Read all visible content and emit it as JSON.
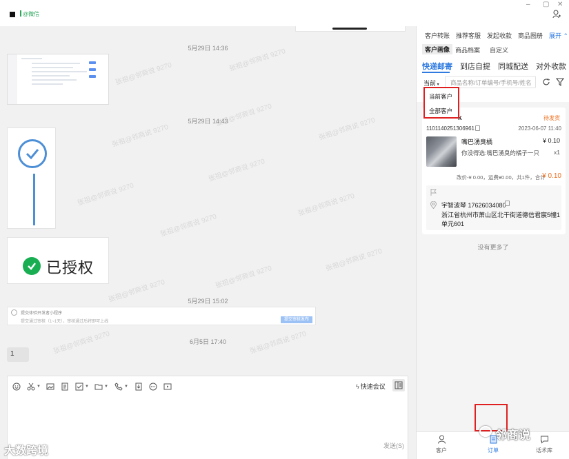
{
  "titlebar": {
    "app_name": "@微信",
    "minimize": "–",
    "maximize": "▢",
    "close": "✕"
  },
  "watermark": {
    "text": "张祖@邻商说 9270"
  },
  "chat": {
    "timestamps": [
      "5月29日 14:36",
      "5月29日 14:43",
      "5月29日 15:02",
      "6月5日 17:40"
    ],
    "auth_text": "已授权",
    "mini_card": {
      "title": "提交体验开发者小程序",
      "subtitle": "提交通过审核（1~1天），审核通过后将即可上线",
      "button": "提交审核发布"
    },
    "message": "1"
  },
  "input": {
    "quick_meeting": "快速会议",
    "send": "发送(S)"
  },
  "brand_watermark": "大数跨境",
  "panel": {
    "nav_top": [
      "客户转账",
      "推荐客服",
      "发起收款",
      "商品图册"
    ],
    "expand": "展开",
    "nav_second": [
      "客户画像",
      "商品档案",
      "自定义"
    ],
    "tabs": [
      "快递邮寄",
      "到店自提",
      "同城配送",
      "对外收款"
    ],
    "filter": "当前",
    "search_placeholder": "商品名称/订单编号/手机号/姓名",
    "dropdown": [
      "当前客户",
      "全部客户"
    ],
    "order": {
      "name": "k",
      "status": "待发货",
      "id": "1101140251306961",
      "date": "2023-06-07 11:40",
      "product_name": "嘴巴湧臭橘",
      "price": "¥ 0.10",
      "desc": "你没得选:嘴巴湧臭的橘子一只",
      "qty": "x1",
      "summary": "改价-¥ 0.00，运费¥0.00，共1件，合计",
      "total": "¥ 0.10",
      "contact": "宇智波琴 17626034080",
      "address_1": "浙江省杭州市萧山区北干街道德信君宸5幢1",
      "address_2": "单元601"
    },
    "no_more": "没有更多了",
    "bottom_nav": [
      "客户",
      "订单",
      "话术库"
    ],
    "brand_overlay": "邻商说"
  }
}
